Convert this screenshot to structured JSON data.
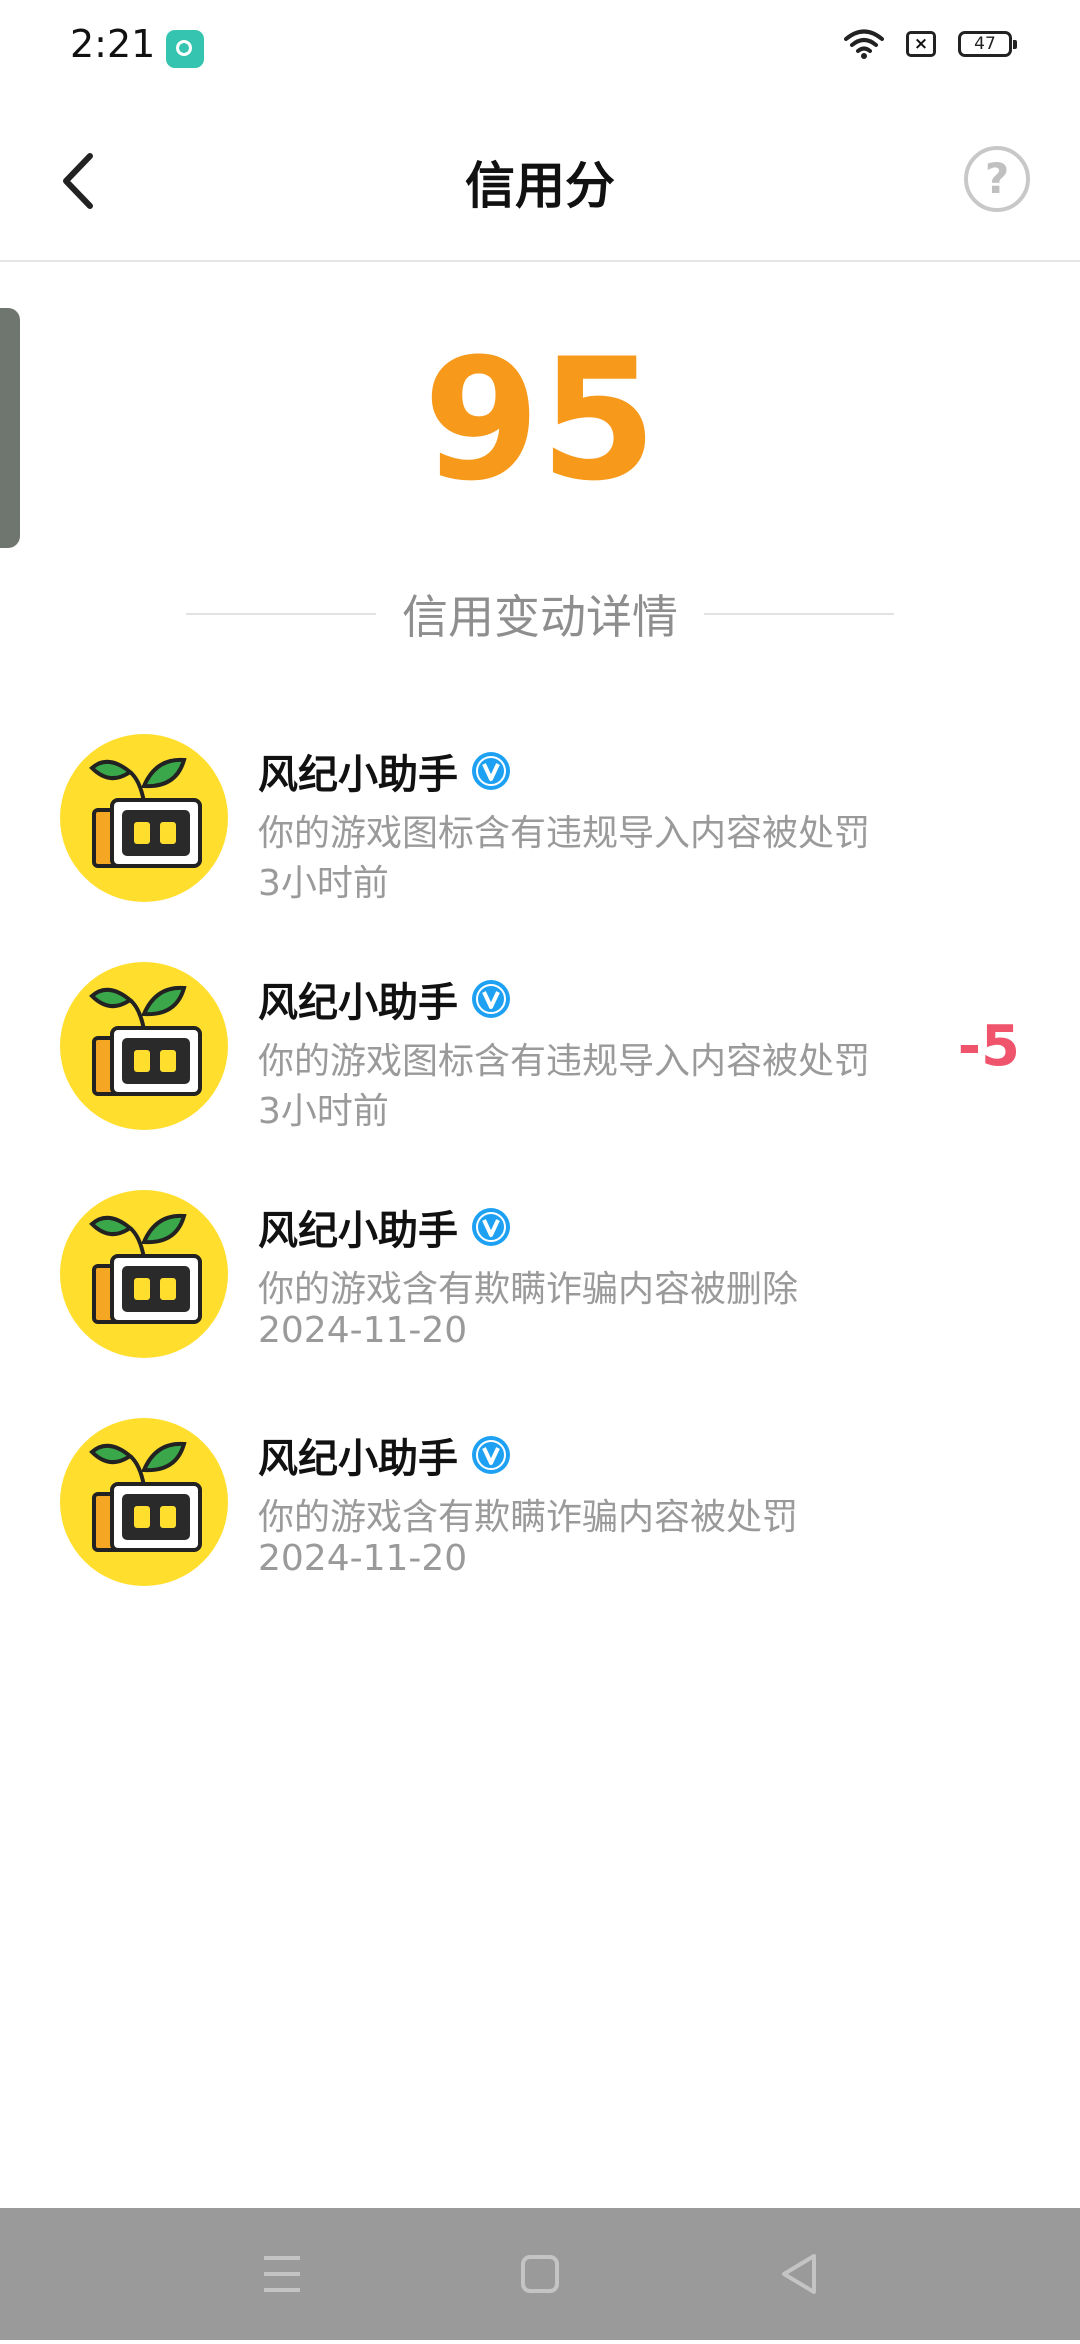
{
  "status_bar": {
    "time": "2:21",
    "battery": "47",
    "icons": [
      "app-notification-icon",
      "wifi-icon",
      "sim-off-icon",
      "battery-icon"
    ]
  },
  "header": {
    "title": "信用分",
    "back_icon": "chevron-left-icon",
    "help_label": "?"
  },
  "score": {
    "value": "95",
    "color": "#f79a1c"
  },
  "section": {
    "title": "信用变动详情"
  },
  "records": [
    {
      "name": "风纪小助手",
      "desc": "你的游戏图标含有违规导入内容被处罚",
      "time": "3小时前",
      "delta": ""
    },
    {
      "name": "风纪小助手",
      "desc": "你的游戏图标含有违规导入内容被处罚",
      "time": "3小时前",
      "delta": "-5"
    },
    {
      "name": "风纪小助手",
      "desc": "你的游戏含有欺瞒诈骗内容被删除",
      "time": "2024-11-20",
      "delta": ""
    },
    {
      "name": "风纪小助手",
      "desc": "你的游戏含有欺瞒诈骗内容被处罚",
      "time": "2024-11-20",
      "delta": ""
    }
  ],
  "colors": {
    "accent": "#f79a1c",
    "negative": "#f0546c",
    "verified": "#1ea1f2",
    "avatar_bg": "#ffde2e"
  },
  "nav_bar": {
    "icons": [
      "menu-icon",
      "home-icon",
      "back-triangle-icon"
    ]
  }
}
